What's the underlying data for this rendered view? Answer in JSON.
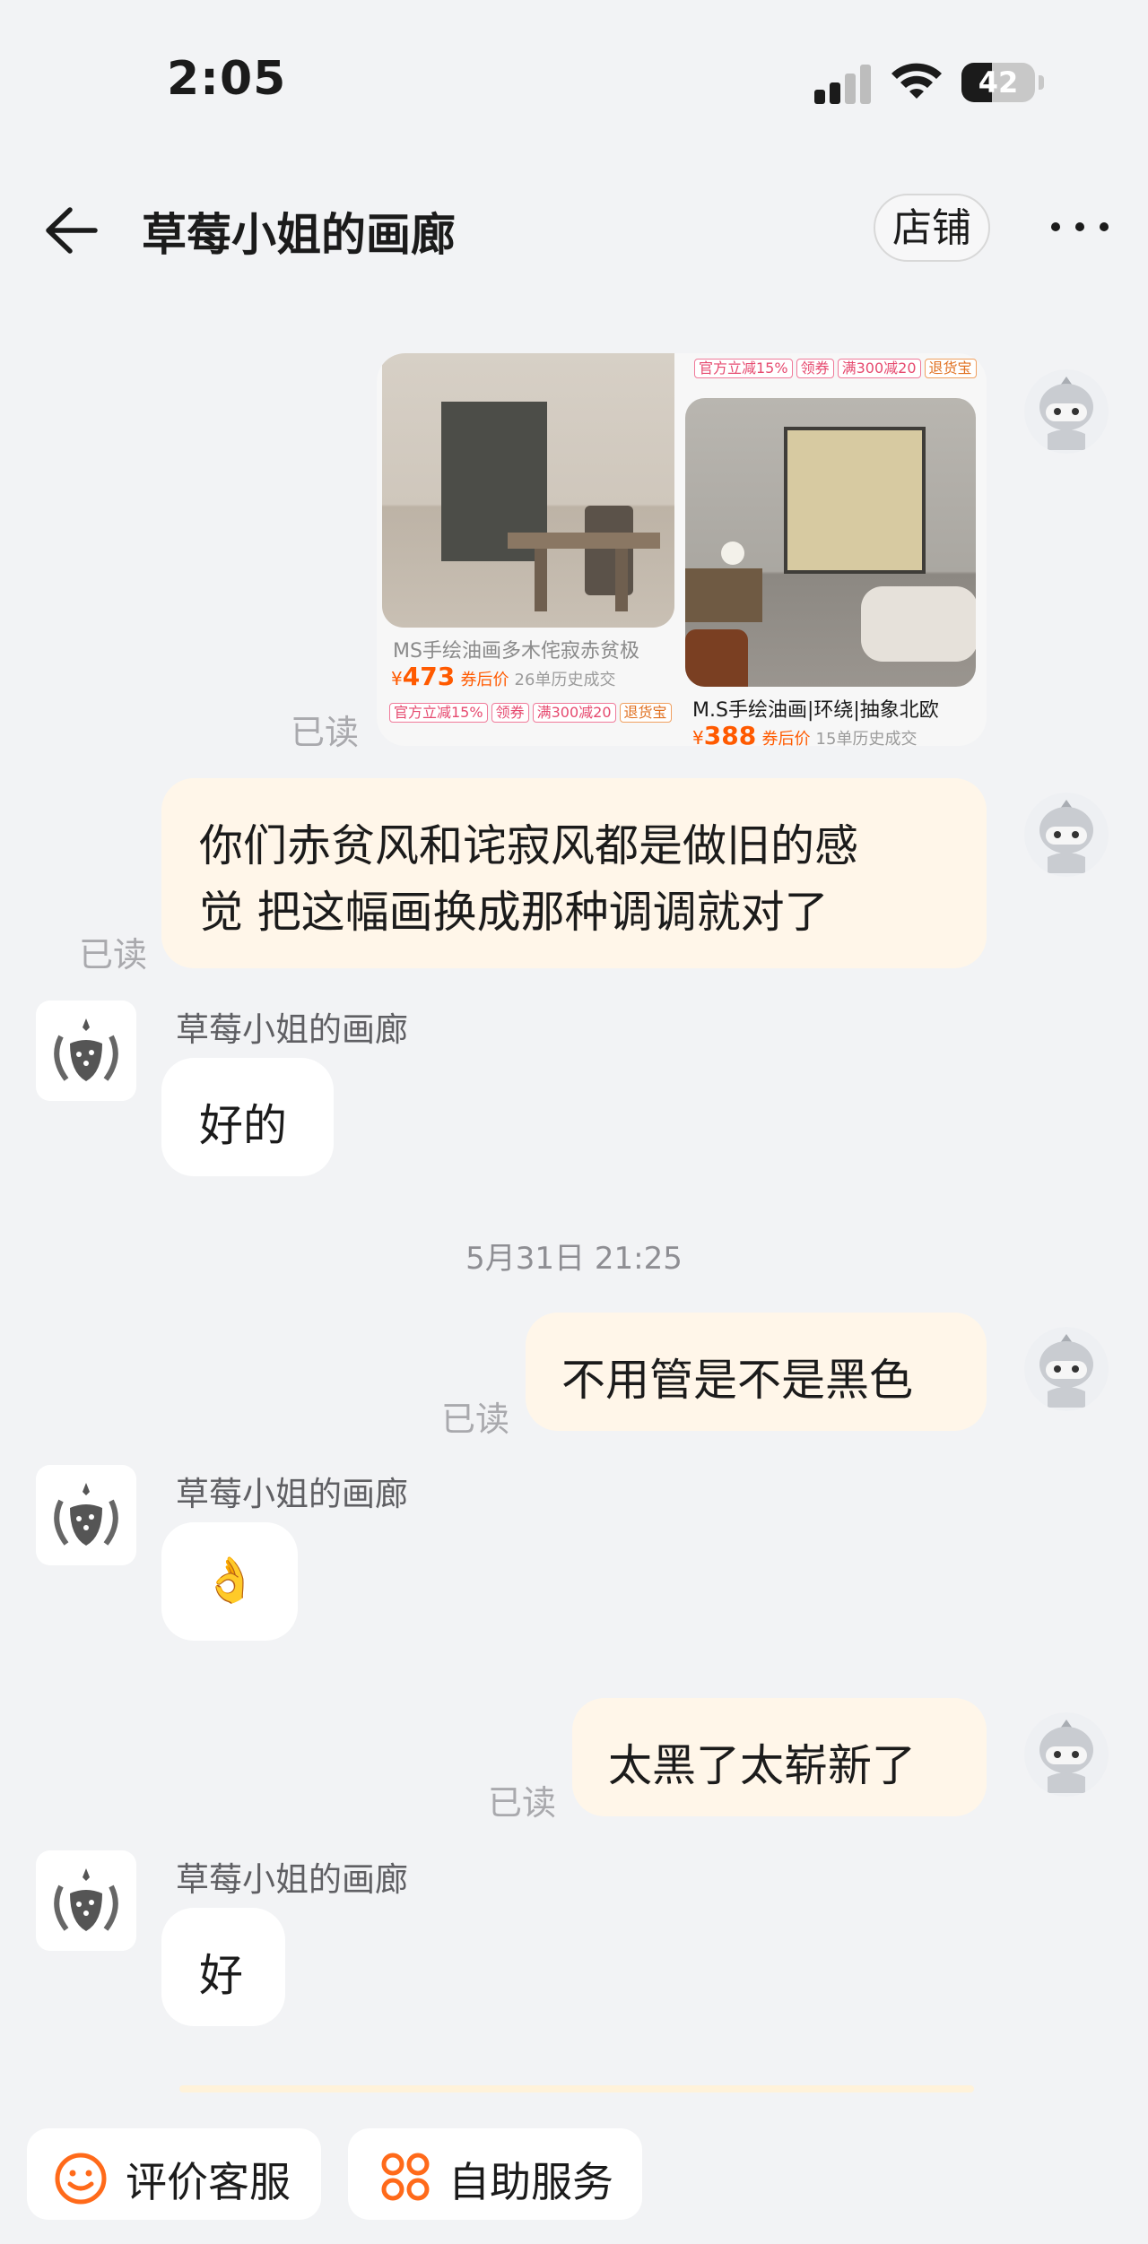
{
  "status_bar": {
    "time": "2:05",
    "battery": 42
  },
  "header": {
    "title": "草莓小姐的画廊",
    "store_label": "店铺"
  },
  "product_card": {
    "items": [
      {
        "title": "MS手绘油画多木侘寂赤贫极",
        "currency": "¥",
        "price": "473",
        "price_label": "券后价",
        "history": "26单历史成交",
        "tags": [
          "官方立减15%",
          "领券",
          "满300减20",
          "退货宝"
        ]
      },
      {
        "title": "M.S手绘油画|环绕|抽象北欧",
        "currency": "¥",
        "price": "388",
        "price_label": "券后价",
        "history": "15单历史成交",
        "tags": [
          "官方立减15%",
          "领券",
          "满300减20",
          "退货宝"
        ]
      }
    ]
  },
  "messages": {
    "read_label": "已读",
    "shop_name": "草莓小姐的画廊",
    "msg1_line1": "你们赤贫风和诧寂风都是做旧的感",
    "msg1_line2": "觉 把这幅画换成那种调调就对了",
    "reply1": "好的",
    "time_divider": "5月31日 21:25",
    "msg2": "不用管是不是黑色",
    "reply2": "👌",
    "msg3": "太黑了太崭新了",
    "reply3": "好"
  },
  "bottom_bar": {
    "rate_service": "评价客服",
    "self_service": "自助服务"
  },
  "colors": {
    "background": "#f2f3f5",
    "my_bubble": "#fff6e9",
    "their_bubble": "#ffffff",
    "accent_orange": "#ff5a00"
  }
}
